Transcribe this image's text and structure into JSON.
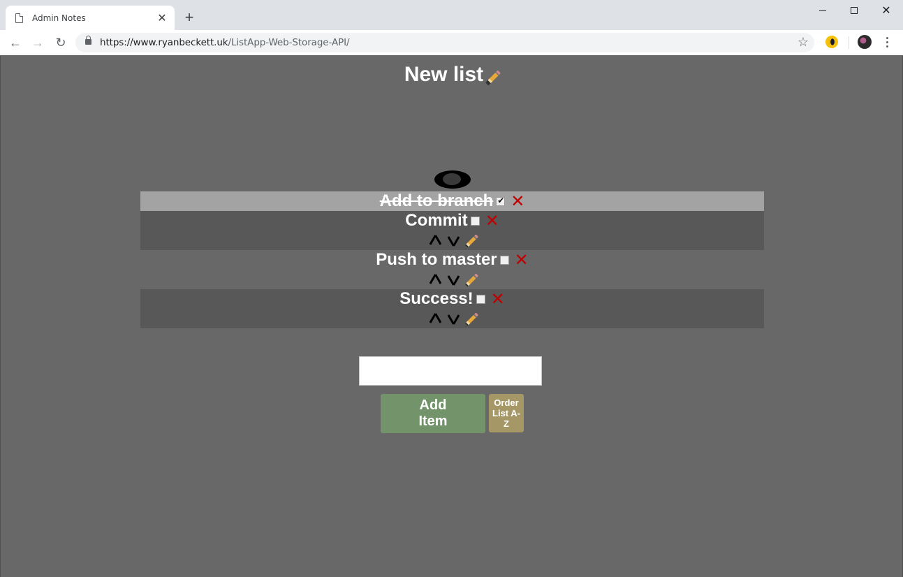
{
  "browser": {
    "tab_title": "Admin Notes",
    "url_host": "https://www.ryanbeckett.uk",
    "url_path": "/ListApp-Web-Storage-API/"
  },
  "page": {
    "list_title": "New list",
    "items": [
      {
        "text": "Add to branch",
        "checked": true
      },
      {
        "text": "Commit",
        "checked": false
      },
      {
        "text": "Push to master",
        "checked": false
      },
      {
        "text": "Success!",
        "checked": false
      }
    ],
    "new_item_input": {
      "value": "",
      "placeholder": ""
    },
    "add_button_label": "Add Item",
    "order_button_label": "Order List A-Z"
  },
  "icons": {
    "edit": "pencil-icon",
    "visibility": "eye-icon",
    "delete": "cross-icon",
    "move_up": "chevron-up-icon",
    "move_down": "chevron-down-icon"
  },
  "colors": {
    "page_background": "#686868",
    "done_row": "#a3a3a3",
    "alt_row": "#585858",
    "delete_red": "#c00000",
    "add_button": "#73946b",
    "order_button": "#a59766"
  }
}
